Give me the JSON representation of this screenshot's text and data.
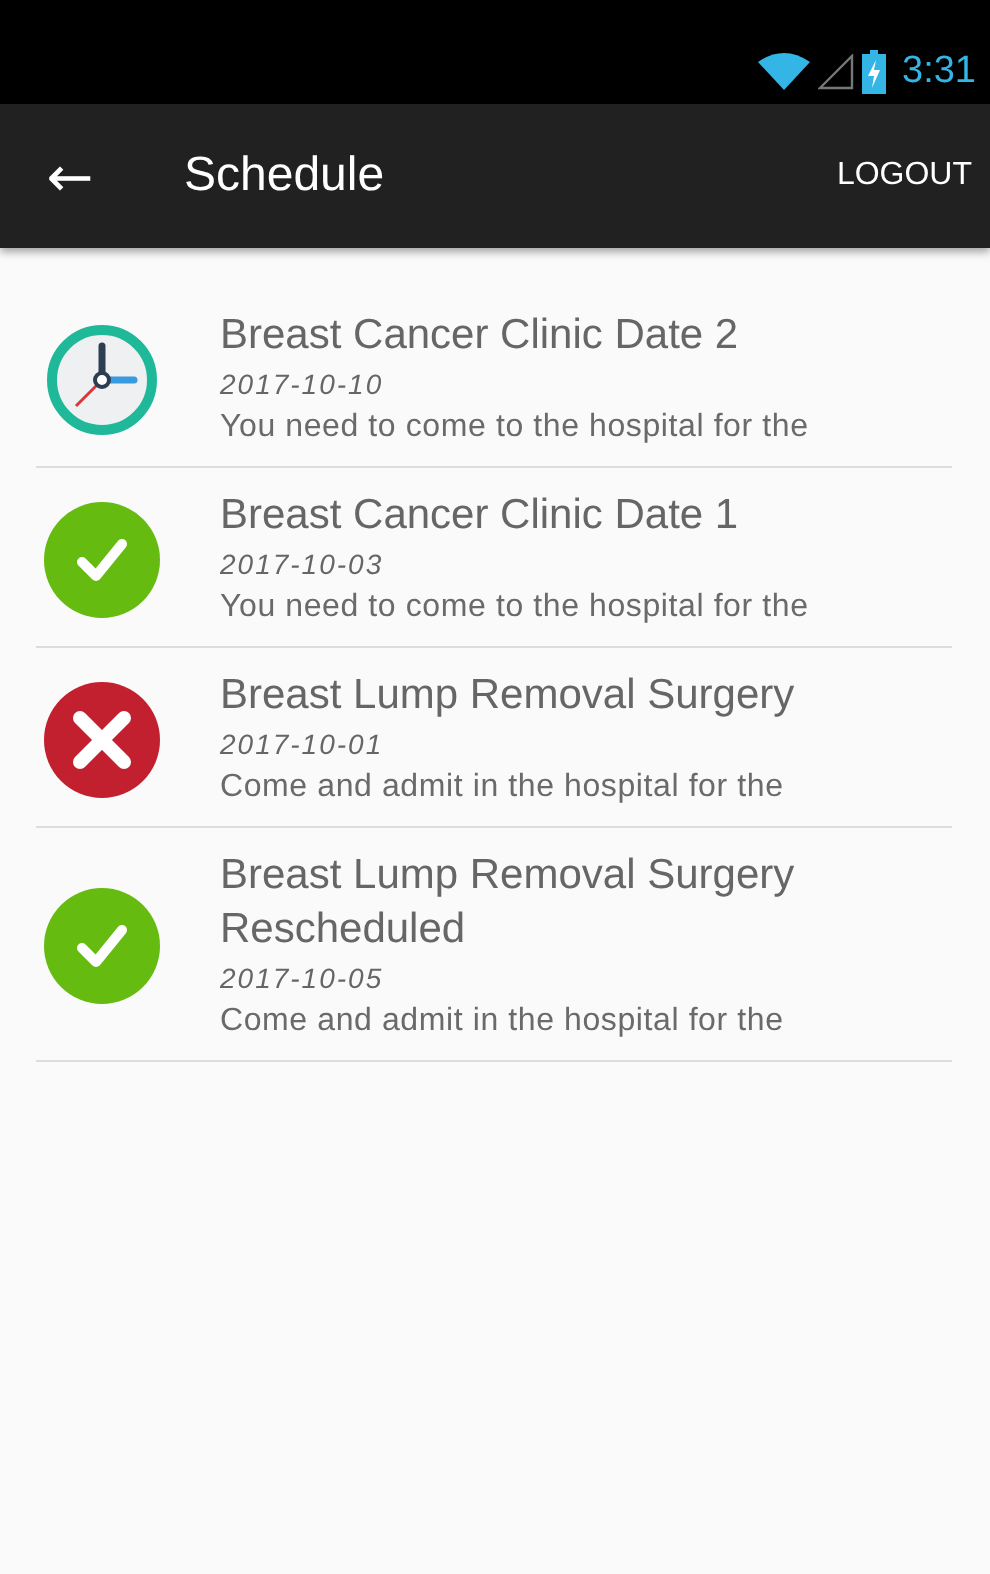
{
  "status_bar": {
    "time": "3:31"
  },
  "app_bar": {
    "back": "←",
    "title": "Schedule",
    "action": "LOGOUT"
  },
  "appointments": [
    {
      "kind": "pending",
      "title": "Breast Cancer Clinic Date 2",
      "date": "2017-10-10",
      "description": "You need to come to the hospital for the"
    },
    {
      "kind": "done",
      "title": "Breast Cancer Clinic Date 1",
      "date": "2017-10-03",
      "description": "You need to come to the hospital for the"
    },
    {
      "kind": "cancelled",
      "title": "Breast Lump Removal Surgery",
      "date": "2017-10-01",
      "description": "Come and admit in the hospital for the"
    },
    {
      "kind": "done",
      "title": "Breast Lump Removal Surgery Rescheduled",
      "date": "2017-10-05",
      "description": "Come and admit in the hospital for the"
    }
  ]
}
